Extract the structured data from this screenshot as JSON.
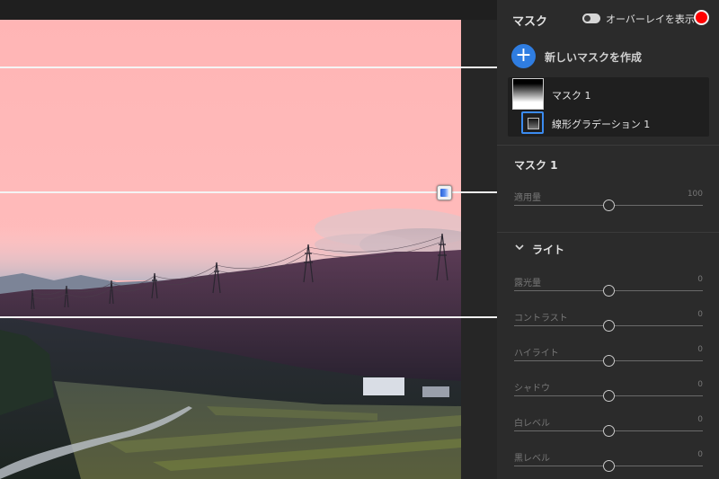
{
  "panel": {
    "title": "マスク",
    "overlay_label": "オーバーレイを表示",
    "overlay_color": "#ff0000",
    "new_mask_label": "新しいマスクを作成",
    "new_mask_icon": "+",
    "mask_list": {
      "mask_name": "マスク 1",
      "component_name": "線形グラデーション 1"
    },
    "mask_section": {
      "title": "マスク 1",
      "amount": {
        "label": "適用量",
        "value": "100",
        "level": 0.5
      }
    },
    "light_section": {
      "title": "ライト",
      "sliders": [
        {
          "label": "露光量",
          "value": "0",
          "level": 0.5
        },
        {
          "label": "コントラスト",
          "value": "0",
          "level": 0.5
        },
        {
          "label": "ハイライト",
          "value": "0",
          "level": 0.5
        },
        {
          "label": "シャドウ",
          "value": "0",
          "level": 0.5
        },
        {
          "label": "白レベル",
          "value": "0",
          "level": 0.5
        },
        {
          "label": "黒レベル",
          "value": "0",
          "level": 0.5
        }
      ]
    }
  },
  "colors": {
    "accent": "#2f7de1",
    "overlay_tint": "#ffb3b3",
    "panel_bg": "#2b2b2b"
  },
  "icons": [
    "plus-icon",
    "toggle-icon",
    "chevron-down-icon",
    "linear-gradient-icon",
    "gradient-handle-icon"
  ]
}
